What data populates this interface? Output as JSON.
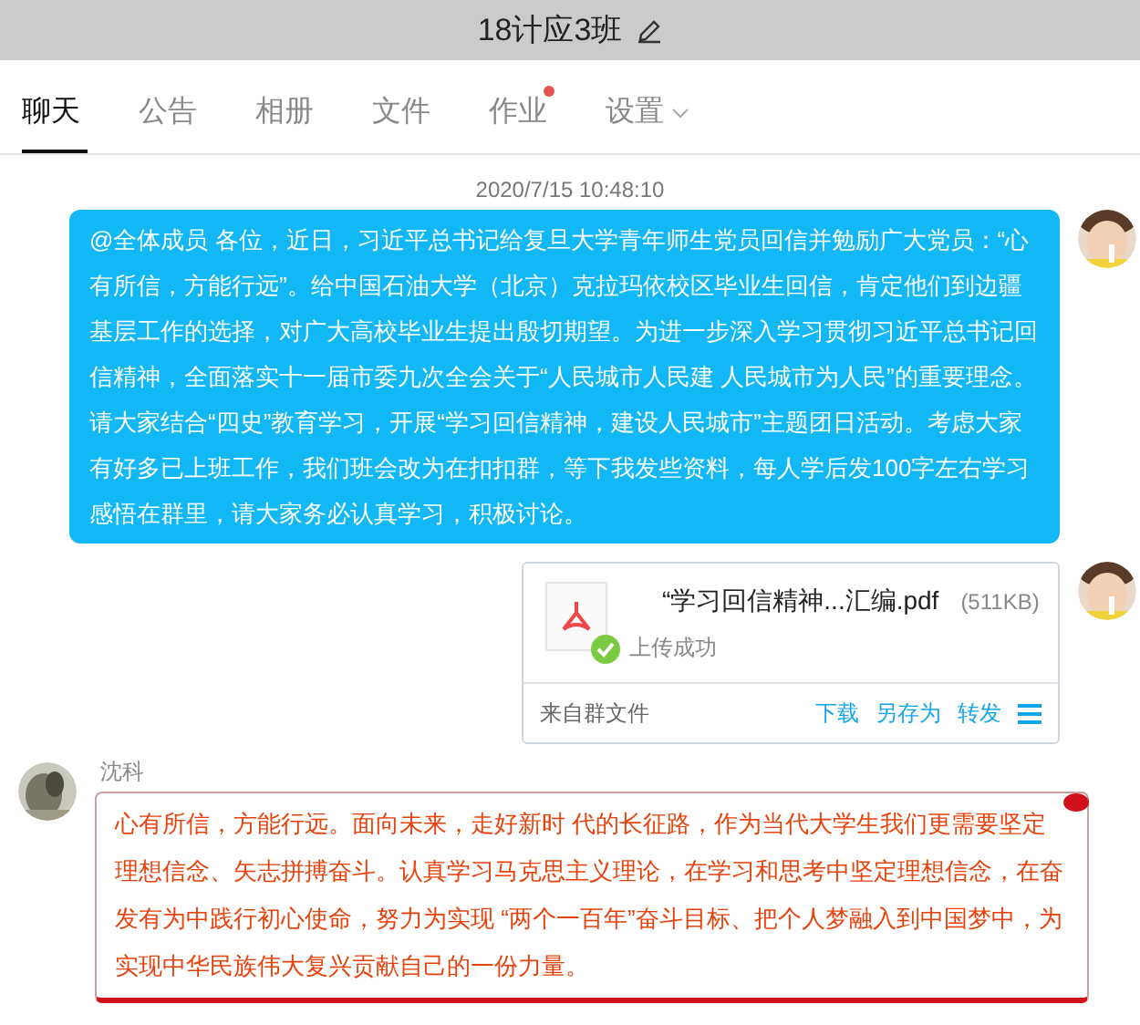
{
  "window": {
    "title": "18计应3班"
  },
  "tabs": [
    {
      "label": "聊天",
      "selected": true,
      "dot": false,
      "menu": false
    },
    {
      "label": "公告",
      "selected": false,
      "dot": false,
      "menu": false
    },
    {
      "label": "相册",
      "selected": false,
      "dot": false,
      "menu": false
    },
    {
      "label": "文件",
      "selected": false,
      "dot": false,
      "menu": false
    },
    {
      "label": "作业",
      "selected": false,
      "dot": true,
      "menu": false
    },
    {
      "label": "设置",
      "selected": false,
      "dot": false,
      "menu": true
    }
  ],
  "timestamp": "2020/7/15 10:48:10",
  "messages": [
    {
      "kind": "text",
      "text": "@全体成员  各位，近日，习近平总书记给复旦大学青年师生党员回信并勉励广大党员：“心有所信，方能行远”。给中国石油大学（北京）克拉玛依校区毕业生回信，肯定他们到边疆基层工作的选择，对广大高校毕业生提出殷切期望。为进一步深入学习贯彻习近平总书记回信精神，全面落实十一届市委九次全会关于“人民城市人民建 人民城市为人民”的重要理念。请大家结合“四史”教育学习，开展“学习回信精神，建设人民城市”主题团日活动。考虑大家有好多已上班工作，我们班会改为在扣扣群，等下我发些资料，每人学后发100字左右学习感悟在群里，请大家务必认真学习，积极讨论。"
    },
    {
      "kind": "file",
      "filename": "“学习回信精神...汇编.pdf",
      "size": "(511KB)",
      "status": "上传成功",
      "source": "来自群文件",
      "actions": [
        "下载",
        "另存为",
        "转发"
      ]
    },
    {
      "kind": "decorated",
      "sender": "沈科",
      "text": "心有所信，方能行远。面向未来，走好新时 代的长征路，作为当代大学生我们更需要坚定理想信念、矢志拼搏奋斗。认真学习马克思主义理论，在学习和思考中坚定理想信念，在奋发有为中践行初心使命，努力为实现 “两个一百年”奋斗目标、把个人梦融入到中国梦中，为实现中华民族伟大复兴贡献自己的一份力量。"
    }
  ]
}
